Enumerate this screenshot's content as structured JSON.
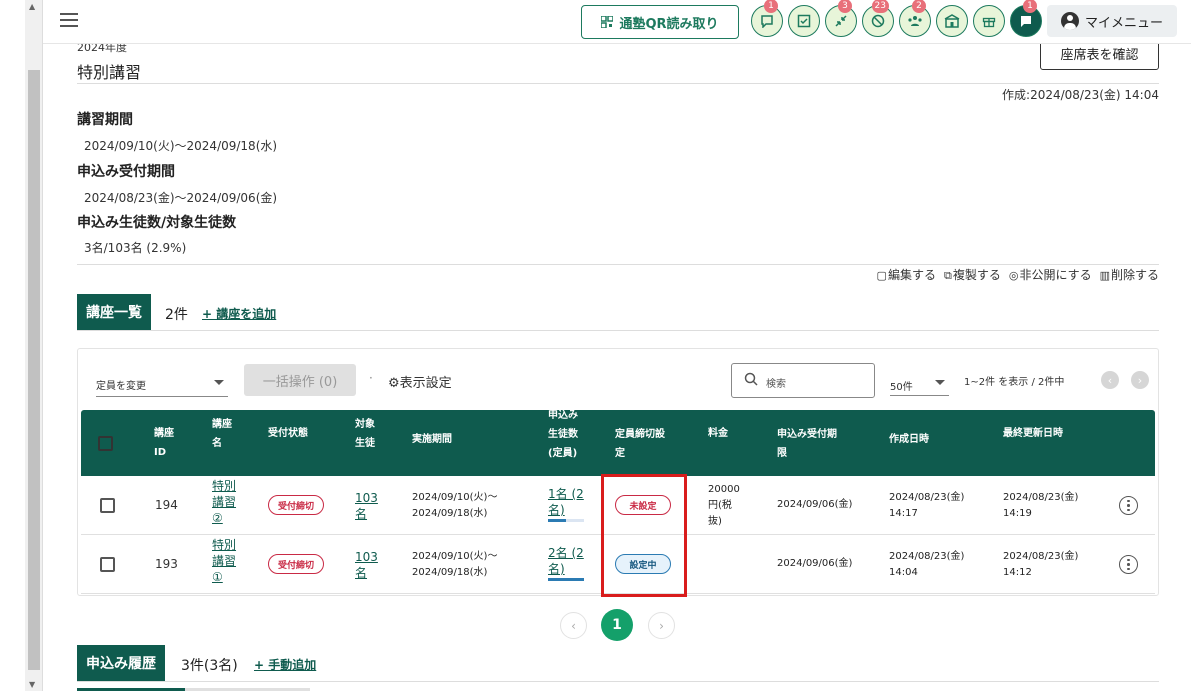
{
  "topbar": {
    "qr_button": "通塾QR読み取り",
    "icons": [
      {
        "name": "chat-icon",
        "badge": "1"
      },
      {
        "name": "checklist-icon",
        "badge": ""
      },
      {
        "name": "shrink-arrows-icon",
        "badge": "3"
      },
      {
        "name": "no-location-icon",
        "badge": "23"
      },
      {
        "name": "group-icon",
        "badge": "2"
      },
      {
        "name": "school-icon",
        "badge": ""
      },
      {
        "name": "gift-icon",
        "badge": ""
      },
      {
        "name": "message-icon",
        "badge": "1"
      }
    ],
    "my_menu": "マイメニュー"
  },
  "header": {
    "year": "2024年度",
    "title": "特別講習",
    "seat_button": "座席表を確認",
    "created": "作成:2024/08/23(金) 14:04"
  },
  "details": {
    "period_label": "講習期間",
    "period_value": "2024/09/10(火)〜2024/09/18(水)",
    "accept_label": "申込み受付期間",
    "accept_value": "2024/08/23(金)〜2024/09/06(金)",
    "students_label": "申込み生徒数/対象生徒数",
    "students_value": "3名/103名 (2.9%)"
  },
  "actions": {
    "edit": "編集する",
    "copy": "複製する",
    "hide": "非公開にする",
    "delete": "削除する"
  },
  "courses": {
    "tab": "講座一覧",
    "count": "2件",
    "add": "+ 講座を追加",
    "toolbar": {
      "select_label": "定員を変更",
      "bulk": "一括操作 (0)",
      "display_settings": "表示設定",
      "search_placeholder": "検索",
      "per_page": "50件",
      "range": "1~2件 を表示 / 2件中"
    },
    "columns": {
      "id": [
        "講座",
        "ID"
      ],
      "name": [
        "講座",
        "名"
      ],
      "status": "受付状態",
      "target": [
        "対象",
        "生徒"
      ],
      "period": "実施期間",
      "applicants": [
        "申込み",
        "生徒数",
        "(定員)"
      ],
      "capacity": [
        "定員締切設",
        "定"
      ],
      "fee": "料金",
      "deadline": [
        "申込み受付期",
        "限"
      ],
      "created": "作成日時",
      "updated": "最終更新日時"
    },
    "rows": [
      {
        "id": "194",
        "name": [
          "特別",
          "講習",
          "②"
        ],
        "status": "受付締切",
        "target": [
          "103",
          "名"
        ],
        "period": [
          "2024/09/10(火)〜",
          "2024/09/18(水)"
        ],
        "applicants": [
          "1名 (2",
          "名)"
        ],
        "fill_fraction": 0.5,
        "capacity": "未設定",
        "fee": [
          "20000",
          "円(税",
          "抜)"
        ],
        "deadline": "2024/09/06(金)",
        "created": [
          "2024/08/23(金)",
          "14:17"
        ],
        "updated": [
          "2024/08/23(金)",
          "14:19"
        ]
      },
      {
        "id": "193",
        "name": [
          "特別",
          "講習",
          "①"
        ],
        "status": "受付締切",
        "target": [
          "103",
          "名"
        ],
        "period": [
          "2024/09/10(火)〜",
          "2024/09/18(水)"
        ],
        "applicants": [
          "2名 (2",
          "名)"
        ],
        "fill_fraction": 1.0,
        "capacity": "設定中",
        "fee": [
          "",
          "",
          ""
        ],
        "deadline": "2024/09/06(金)",
        "created": [
          "2024/08/23(金)",
          "14:04"
        ],
        "updated": [
          "2024/08/23(金)",
          "14:12"
        ]
      }
    ],
    "pager": {
      "current": "1",
      "prev": "‹",
      "next": "›"
    }
  },
  "history": {
    "tab": "申込み履歴",
    "count": "3件(3名)",
    "add": "+ 手動追加"
  }
}
